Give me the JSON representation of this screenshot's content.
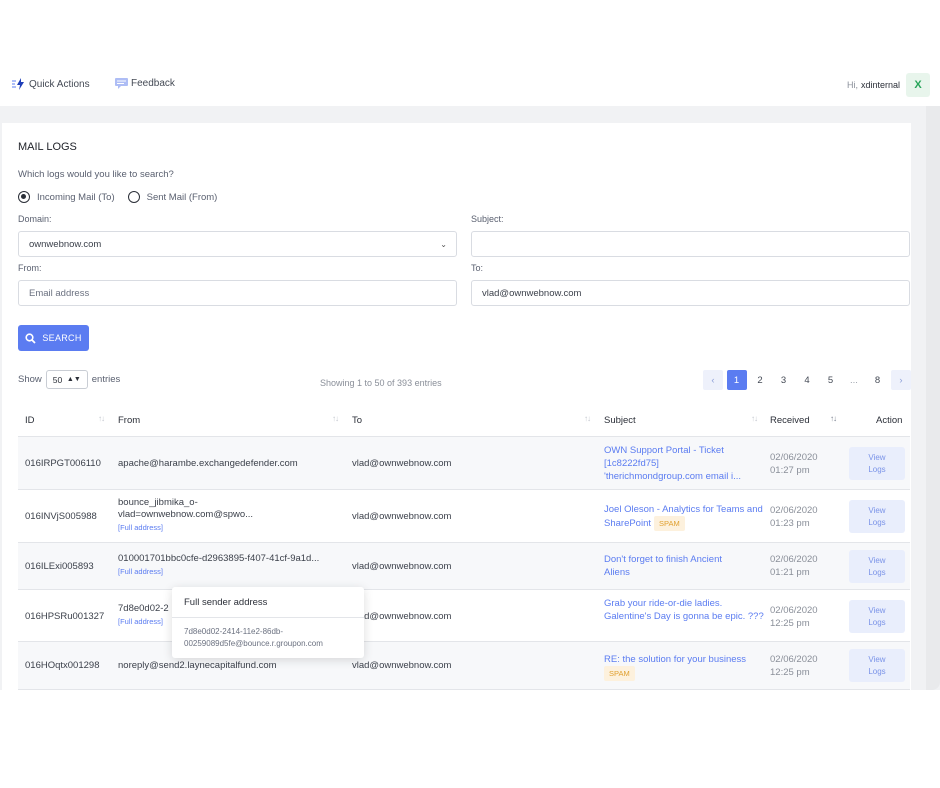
{
  "topbar": {
    "quick_actions": "Quick Actions",
    "feedback": "Feedback",
    "greeting": "Hi,",
    "username": "xdinternal",
    "avatar_letter": "X"
  },
  "page": {
    "title": "MAIL LOGS",
    "question": "Which logs would you like to search?",
    "radio_incoming": "Incoming Mail (To)",
    "radio_sent": "Sent Mail (From)",
    "domain_label": "Domain:",
    "domain_value": "ownwebnow.com",
    "subject_label": "Subject:",
    "subject_value": "",
    "from_label": "From:",
    "from_placeholder": "Email address",
    "to_label": "To:",
    "to_value": "vlad@ownwebnow.com",
    "search_button": "SEARCH"
  },
  "listing": {
    "show": "Show",
    "page_size": "50",
    "entries": "entries",
    "showing": "Showing 1 to 50 of 393 entries",
    "pages": [
      "1",
      "2",
      "3",
      "4",
      "5",
      "...",
      "8"
    ],
    "prev": "‹",
    "next": "›"
  },
  "table": {
    "headers": {
      "id": "ID",
      "from": "From",
      "to": "To",
      "subject": "Subject",
      "received": "Received",
      "action": "Action"
    },
    "view_label_1": "View",
    "view_label_2": "Logs",
    "full_address": "[Full address]",
    "spam": "SPAM",
    "rows": [
      {
        "id": "016IRPGT006110",
        "from": "apache@harambe.exchangedefender.com",
        "from2": "",
        "to": "vlad@ownwebnow.com",
        "subject": "OWN Support Portal - Ticket [1c8222fd75] 'therichmondgroup.com email i...",
        "date": "02/06/2020",
        "time": "01:27 pm"
      },
      {
        "id": "016INVjS005988",
        "from": "bounce_jibmika_o-",
        "from2": "vlad=ownwebnow.com@spwo...",
        "to": "vlad@ownwebnow.com",
        "subject": "Joel Oleson - Analytics for Teams and SharePoint",
        "date": "02/06/2020",
        "time": "01:23 pm"
      },
      {
        "id": "016ILExi005893",
        "from": "010001701bbc0cfe-d2963895-f407-41cf-9a1d...",
        "from2": "",
        "to": "vlad@ownwebnow.com",
        "subject": "Don't forget to finish Ancient Aliens",
        "date": "02/06/2020",
        "time": "01:21 pm"
      },
      {
        "id": "016HPSRu001327",
        "from": "7d8e0d02-2",
        "from2": "",
        "to": "vlad@ownwebnow.com",
        "subject": "Grab your ride-or-die ladies. Galentine's Day is gonna be epic. ???",
        "date": "02/06/2020",
        "time": "12:25 pm"
      },
      {
        "id": "016HOqtx001298",
        "from": "noreply@send2.laynecapitalfund.com",
        "from2": "",
        "to": "vlad@ownwebnow.com",
        "subject": "RE: the solution for your business",
        "date": "02/06/2020",
        "time": "12:25 pm"
      }
    ]
  },
  "popover": {
    "title": "Full sender address",
    "line1": "7d8e0d02-2414-11e2-86db-",
    "line2": "00259089d5fe@bounce.r.groupon.com"
  },
  "colors": {
    "accent": "#5b7cf1",
    "spam_bg": "#fdf1dd",
    "spam_fg": "#e0a030",
    "avatar_fg": "#27a55a"
  }
}
